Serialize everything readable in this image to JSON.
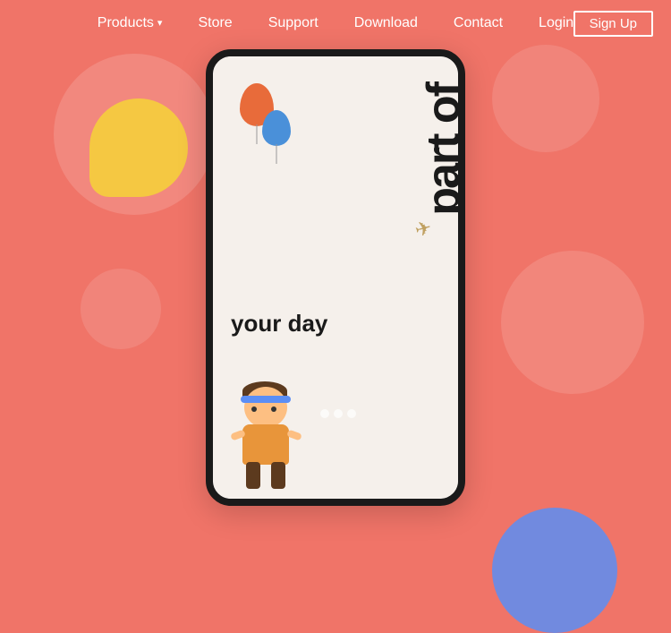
{
  "nav": {
    "items": [
      {
        "label": "Products",
        "hasDropdown": true
      },
      {
        "label": "Store",
        "hasDropdown": false
      },
      {
        "label": "Support",
        "hasDropdown": false
      },
      {
        "label": "Download",
        "hasDropdown": false
      },
      {
        "label": "Contact",
        "hasDropdown": false
      },
      {
        "label": "Login",
        "hasDropdown": false
      }
    ],
    "signup_label": "Sign Up"
  },
  "hero": {
    "vertical_text": "part of",
    "tagline": "your day",
    "background_color": "#F07468",
    "balloon_orange_color": "#E86B3A",
    "balloon_blue_color": "#4A90D9"
  }
}
